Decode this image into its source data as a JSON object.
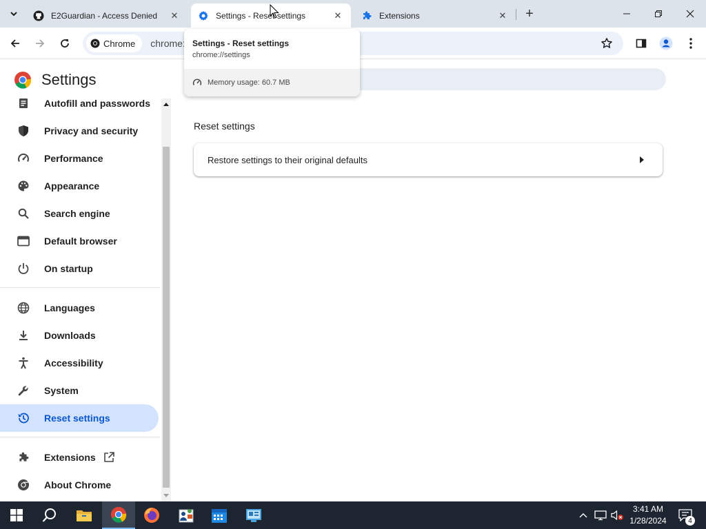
{
  "tabs": [
    {
      "title": "E2Guardian - Access Denied",
      "icon": "github-icon"
    },
    {
      "title": "Settings - Reset settings",
      "icon": "gear-icon"
    },
    {
      "title": "Extensions",
      "icon": "puzzle-icon"
    }
  ],
  "toolbar": {
    "site_chip": "Chrome",
    "url": "chrome://"
  },
  "hover_card": {
    "title": "Settings - Reset settings",
    "url": "chrome://settings",
    "memory": "Memory usage: 60.7 MB"
  },
  "settings": {
    "title": "Settings",
    "nav": [
      {
        "label": "Autofill and passwords",
        "icon": "autofill-icon"
      },
      {
        "label": "Privacy and security",
        "icon": "shield-icon"
      },
      {
        "label": "Performance",
        "icon": "gauge-icon"
      },
      {
        "label": "Appearance",
        "icon": "palette-icon"
      },
      {
        "label": "Search engine",
        "icon": "search-icon"
      },
      {
        "label": "Default browser",
        "icon": "browser-window-icon"
      },
      {
        "label": "On startup",
        "icon": "power-icon"
      },
      {
        "label": "Languages",
        "icon": "globe-icon"
      },
      {
        "label": "Downloads",
        "icon": "download-icon"
      },
      {
        "label": "Accessibility",
        "icon": "accessibility-icon"
      },
      {
        "label": "System",
        "icon": "wrench-icon"
      },
      {
        "label": "Reset settings",
        "icon": "history-icon",
        "selected": true
      },
      {
        "label": "Extensions",
        "icon": "puzzle-icon"
      },
      {
        "label": "About Chrome",
        "icon": "chrome-icon"
      }
    ],
    "section_title": "Reset settings",
    "restore_row": "Restore settings to their original defaults"
  },
  "taskbar": {
    "time": "3:41 AM",
    "date": "1/28/2024",
    "notification_count": "4"
  },
  "colors": {
    "tabstrip_bg": "#dde3ea",
    "selected_nav_bg": "#d3e3fd",
    "accent": "#0b57d0",
    "taskbar_bg": "#1d2531"
  }
}
